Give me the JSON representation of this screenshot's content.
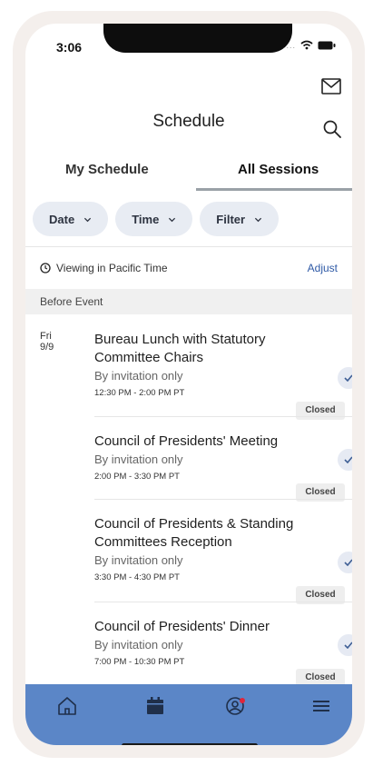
{
  "status": {
    "time": "3:06"
  },
  "header": {
    "title": "Schedule"
  },
  "tabs": [
    {
      "label": "My Schedule",
      "active": false
    },
    {
      "label": "All Sessions",
      "active": true
    }
  ],
  "filters": [
    {
      "label": "Date"
    },
    {
      "label": "Time"
    },
    {
      "label": "Filter"
    }
  ],
  "timezone": {
    "text": "Viewing in Pacific Time",
    "action": "Adjust"
  },
  "section": {
    "label": "Before Event"
  },
  "day": {
    "weekday": "Fri",
    "date": "9/9"
  },
  "sessions": [
    {
      "title": "Bureau Lunch with Statutory Committee Chairs",
      "subtitle": "By invitation only",
      "time": "12:30 PM - 2:00 PM PT",
      "status": "Closed"
    },
    {
      "title": "Council of Presidents' Meeting",
      "subtitle": "By invitation only",
      "time": "2:00 PM - 3:30 PM PT",
      "status": "Closed"
    },
    {
      "title": "Council of Presidents & Standing Committees Reception",
      "subtitle": "By invitation only",
      "time": "3:30 PM - 4:30 PM PT",
      "status": "Closed"
    },
    {
      "title": "Council of Presidents' Dinner",
      "subtitle": "By invitation only",
      "time": "7:00 PM - 10:30 PM PT",
      "status": "Closed"
    }
  ],
  "nav": {
    "icons": [
      "home-icon",
      "calendar-icon",
      "profile-icon",
      "menu-icon"
    ]
  },
  "colors": {
    "nav_bg": "#5b86c7",
    "accent": "#2f5aa6",
    "chip_bg": "#e8ecf3",
    "badge_dot": "#e0253a"
  }
}
